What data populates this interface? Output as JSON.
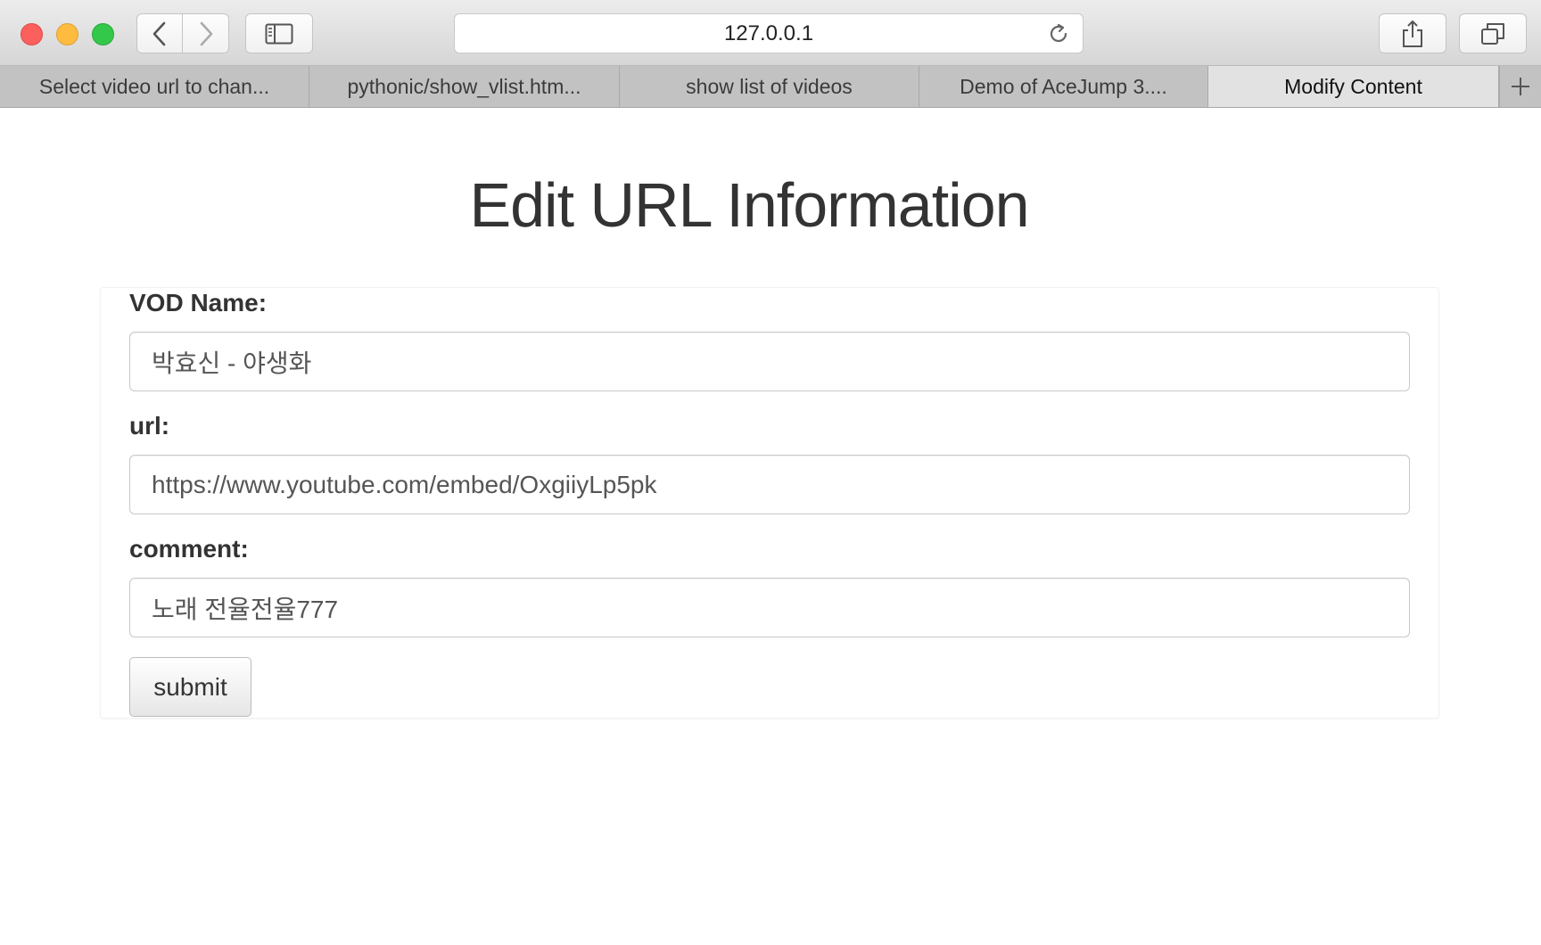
{
  "browser": {
    "address": "127.0.0.1",
    "tabs": [
      {
        "label": "Select video url to chan..."
      },
      {
        "label": "pythonic/show_vlist.htm..."
      },
      {
        "label": "show list of videos"
      },
      {
        "label": "Demo of AceJump 3...."
      },
      {
        "label": "Modify Content"
      }
    ],
    "icons": {
      "back": "chevron-left-icon",
      "forward": "chevron-right-icon",
      "sidebar": "sidebar-icon",
      "reload": "reload-icon",
      "share": "share-icon",
      "tabs": "tabs-overview-icon",
      "new_tab": "plus-icon"
    }
  },
  "page": {
    "title": "Edit URL Information",
    "form": {
      "vod_name": {
        "label": "VOD Name:",
        "value": "박효신 - 야생화"
      },
      "url": {
        "label": "url:",
        "value": "https://www.youtube.com/embed/OxgiiyLp5pk"
      },
      "comment": {
        "label": "comment:",
        "value": "노래 전율전율777"
      },
      "submit_label": "submit"
    }
  }
}
